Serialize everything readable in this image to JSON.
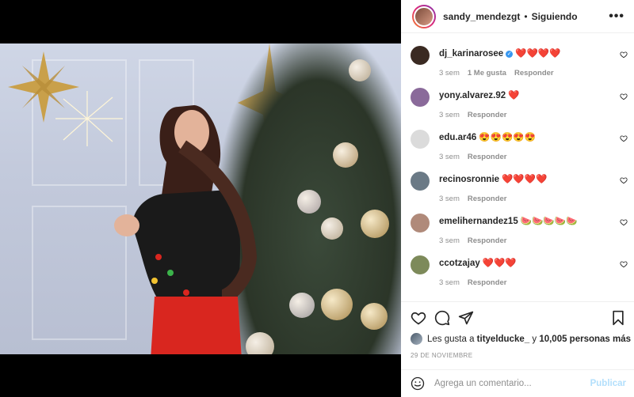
{
  "header": {
    "username": "sandy_mendezgt",
    "separator": "•",
    "follow_status": "Siguiendo"
  },
  "comments": [
    {
      "username": "dj_karinarosee",
      "verified": true,
      "text": "❤️❤️❤️❤️",
      "time": "3 sem",
      "likes": "1 Me gusta",
      "reply": "Responder",
      "avatar_color": "#3a2a22"
    },
    {
      "username": "yony.alvarez.92",
      "verified": false,
      "text": "❤️",
      "time": "3 sem",
      "likes": "",
      "reply": "Responder",
      "avatar_color": "#8a6a9a"
    },
    {
      "username": "edu.ar46",
      "verified": false,
      "text": "😍😍😍😍😍",
      "time": "3 sem",
      "likes": "",
      "reply": "Responder",
      "avatar_color": "#dbdbdb"
    },
    {
      "username": "recinosronnie",
      "verified": false,
      "text": "❤️❤️❤️❤️",
      "time": "3 sem",
      "likes": "",
      "reply": "Responder",
      "avatar_color": "#6b7a86"
    },
    {
      "username": "emelihernandez15",
      "verified": false,
      "text": "🍉🍉🍉🍉🍉",
      "time": "3 sem",
      "likes": "",
      "reply": "Responder",
      "avatar_color": "#b08a7a"
    },
    {
      "username": "ccotzajay",
      "verified": false,
      "text": "❤️❤️❤️",
      "time": "3 sem",
      "likes": "",
      "reply": "Responder",
      "avatar_color": "#7d8a5a"
    }
  ],
  "likes": {
    "prefix": "Les gusta a",
    "user": "tityelducke_",
    "middle": "y",
    "count": "10,005 personas más"
  },
  "date": "29 DE NOVIEMBRE",
  "add_comment": {
    "placeholder": "Agrega un comentario...",
    "publish": "Publicar"
  },
  "icons": [
    "more-icon",
    "heart-icon",
    "comment-icon",
    "share-icon",
    "bookmark-icon",
    "emoji-icon"
  ],
  "colors": {
    "link_blue": "#b2dffc",
    "meta_gray": "#8e8e8e",
    "text": "#262626"
  }
}
